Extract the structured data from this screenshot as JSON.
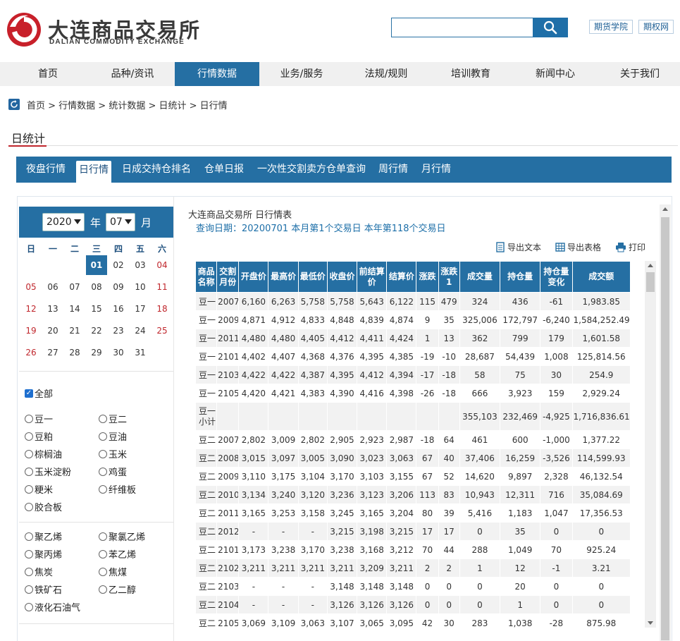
{
  "header": {
    "logo_cn": "大连商品交易所",
    "logo_en": "DALIAN COMMODITY EXCHANGE",
    "search_placeholder": "",
    "links": [
      "期货学院",
      "期权网"
    ]
  },
  "nav": [
    "首页",
    "品种/资讯",
    "行情数据",
    "业务/服务",
    "法规/规则",
    "培训教育",
    "新闻中心",
    "关于我们"
  ],
  "nav_active": "行情数据",
  "breadcrumb": "首页 > 行情数据 > 统计数据 > 日统计 > 日行情",
  "page_title": "日统计",
  "tabs": [
    "夜盘行情",
    "日行情",
    "日成交持仓排名",
    "仓单日报",
    "一次性交割卖方仓单查询",
    "周行情",
    "月行情"
  ],
  "tab_active": "日行情",
  "calendar": {
    "year": "2020",
    "year_label": "年",
    "month": "07",
    "month_label": "月",
    "weekdays": [
      "日",
      "一",
      "二",
      "三",
      "四",
      "五",
      "六"
    ],
    "days": [
      "01",
      "02",
      "03",
      "04",
      "05",
      "06",
      "07",
      "08",
      "09",
      "10",
      "11",
      "12",
      "13",
      "14",
      "15",
      "16",
      "17",
      "18",
      "19",
      "20",
      "21",
      "22",
      "23",
      "24",
      "25",
      "26",
      "27",
      "28",
      "29",
      "30",
      "31"
    ],
    "selected": "01"
  },
  "filters": {
    "all_label": "全部",
    "group1": [
      "豆一",
      "豆二",
      "豆粕",
      "豆油",
      "棕榈油",
      "玉米",
      "玉米淀粉",
      "鸡蛋",
      "粳米",
      "纤维板",
      "胶合板"
    ],
    "group2": [
      "聚乙烯",
      "聚氯乙烯",
      "聚丙烯",
      "苯乙烯",
      "焦炭",
      "焦煤",
      "铁矿石",
      "乙二醇",
      "液化石油气"
    ]
  },
  "report": {
    "title": "大连商品交易所 日行情表",
    "query_date": "查询日期：20200701 本月第1个交易日 本年第118个交易日",
    "tools": [
      "导出文本",
      "导出表格",
      "打印"
    ]
  },
  "table": {
    "headers": [
      "商品名称",
      "交割月份",
      "开盘价",
      "最高价",
      "最低价",
      "收盘价",
      "前结算价",
      "结算价",
      "涨跌",
      "涨跌1",
      "成交量",
      "持仓量",
      "持仓量变化",
      "成交额"
    ],
    "rows": [
      [
        "豆一",
        "2007",
        "6,160",
        "6,263",
        "5,758",
        "5,758",
        "5,643",
        "6,122",
        "115",
        "479",
        "324",
        "436",
        "-61",
        "1,983.85"
      ],
      [
        "豆一",
        "2009",
        "4,871",
        "4,912",
        "4,833",
        "4,848",
        "4,839",
        "4,874",
        "9",
        "35",
        "325,006",
        "172,797",
        "-6,240",
        "1,584,252.49"
      ],
      [
        "豆一",
        "2011",
        "4,480",
        "4,480",
        "4,405",
        "4,412",
        "4,411",
        "4,424",
        "1",
        "13",
        "362",
        "799",
        "179",
        "1,601.58"
      ],
      [
        "豆一",
        "2101",
        "4,402",
        "4,407",
        "4,368",
        "4,376",
        "4,395",
        "4,385",
        "-19",
        "-10",
        "28,687",
        "54,439",
        "1,008",
        "125,814.56"
      ],
      [
        "豆一",
        "2103",
        "4,422",
        "4,422",
        "4,387",
        "4,395",
        "4,412",
        "4,394",
        "-17",
        "-18",
        "58",
        "75",
        "30",
        "254.9"
      ],
      [
        "豆一",
        "2105",
        "4,420",
        "4,421",
        "4,383",
        "4,390",
        "4,416",
        "4,398",
        "-26",
        "-18",
        "666",
        "3,923",
        "159",
        "2,929.24"
      ],
      [
        "豆一小计",
        "",
        "",
        "",
        "",
        "",
        "",
        "",
        "",
        "",
        "355,103",
        "232,469",
        "-4,925",
        "1,716,836.61"
      ],
      [
        "豆二",
        "2007",
        "2,802",
        "3,009",
        "2,802",
        "2,905",
        "2,923",
        "2,987",
        "-18",
        "64",
        "461",
        "600",
        "-1,000",
        "1,377.22"
      ],
      [
        "豆二",
        "2008",
        "3,015",
        "3,097",
        "3,005",
        "3,090",
        "3,023",
        "3,063",
        "67",
        "40",
        "37,406",
        "16,259",
        "-3,526",
        "114,599.93"
      ],
      [
        "豆二",
        "2009",
        "3,110",
        "3,175",
        "3,104",
        "3,170",
        "3,103",
        "3,155",
        "67",
        "52",
        "14,620",
        "9,897",
        "2,328",
        "46,132.54"
      ],
      [
        "豆二",
        "2010",
        "3,134",
        "3,240",
        "3,120",
        "3,236",
        "3,123",
        "3,206",
        "113",
        "83",
        "10,943",
        "12,311",
        "716",
        "35,084.69"
      ],
      [
        "豆二",
        "2011",
        "3,165",
        "3,253",
        "3,158",
        "3,245",
        "3,165",
        "3,204",
        "80",
        "39",
        "5,416",
        "1,183",
        "1,047",
        "17,356.53"
      ],
      [
        "豆二",
        "2012",
        "-",
        "-",
        "-",
        "3,215",
        "3,198",
        "3,215",
        "17",
        "17",
        "0",
        "35",
        "0",
        "0"
      ],
      [
        "豆二",
        "2101",
        "3,173",
        "3,238",
        "3,170",
        "3,238",
        "3,168",
        "3,212",
        "70",
        "44",
        "288",
        "1,049",
        "70",
        "925.24"
      ],
      [
        "豆二",
        "2102",
        "3,211",
        "3,211",
        "3,211",
        "3,211",
        "3,209",
        "3,211",
        "2",
        "2",
        "1",
        "12",
        "-1",
        "3.21"
      ],
      [
        "豆二",
        "2103",
        "-",
        "-",
        "-",
        "3,148",
        "3,148",
        "3,148",
        "0",
        "0",
        "0",
        "20",
        "0",
        "0"
      ],
      [
        "豆二",
        "2104",
        "-",
        "-",
        "-",
        "3,126",
        "3,126",
        "3,126",
        "0",
        "0",
        "0",
        "1",
        "0",
        "0"
      ],
      [
        "豆二",
        "2105",
        "3,069",
        "3,109",
        "3,063",
        "3,107",
        "3,065",
        "3,095",
        "42",
        "30",
        "283",
        "1,038",
        "-28",
        "875.98"
      ]
    ]
  },
  "colors": {
    "primary": "#256fa3",
    "weekend": "#c0272d",
    "accent_red": "#c0272d"
  }
}
